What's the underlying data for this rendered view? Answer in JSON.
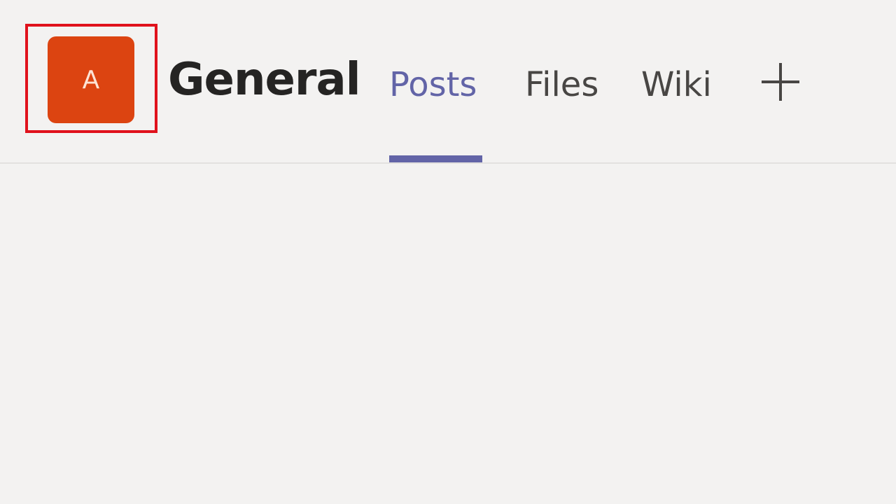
{
  "channel": {
    "avatar_initial": "A",
    "avatar_color": "#dc4411",
    "title": "General"
  },
  "tabs": [
    {
      "label": "Posts",
      "active": true
    },
    {
      "label": "Files",
      "active": false
    },
    {
      "label": "Wiki",
      "active": false
    }
  ],
  "add_tab_icon": "plus-icon",
  "colors": {
    "accent": "#6264a7",
    "highlight": "#e0121c",
    "background": "#f3f2f1"
  }
}
